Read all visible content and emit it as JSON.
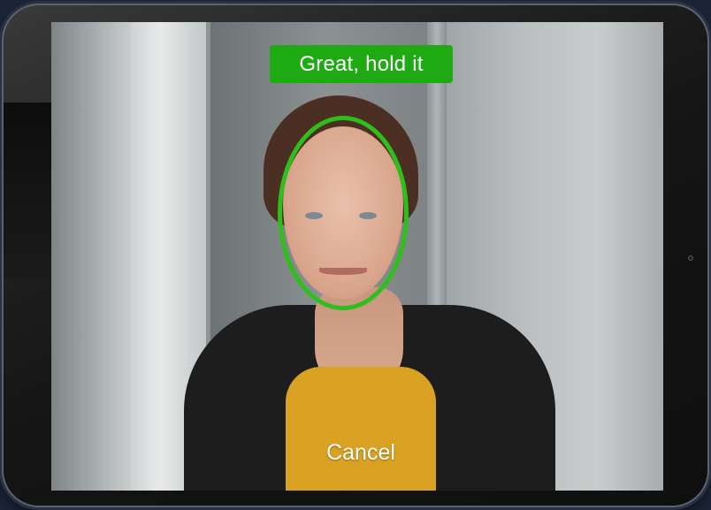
{
  "screen": {
    "status_message": "Great, hold it",
    "cancel_label": "Cancel"
  },
  "colors": {
    "status_background": "#1faa13",
    "face_guide": "#2fbf1c",
    "text": "#ffffff"
  }
}
